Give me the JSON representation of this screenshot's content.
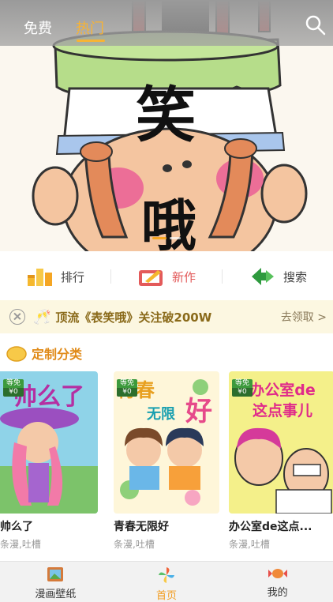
{
  "top_tabs": {
    "free": "免费",
    "hot": "热门"
  },
  "hero": {
    "big_char_1": "笑",
    "big_char_2": "哦"
  },
  "quick_nav": [
    {
      "label": "排行",
      "icon": "ranking-icon"
    },
    {
      "label": "新作",
      "icon": "new-work-icon"
    },
    {
      "label": "搜索",
      "icon": "search-arrows-icon"
    }
  ],
  "notice": {
    "text": "顶流《表笑哦》关注破200W",
    "action": "去领取 >"
  },
  "section": {
    "title": "定制分类"
  },
  "badge": {
    "line1": "等免",
    "line2": "¥0"
  },
  "cards": [
    {
      "cover_text": "帅么了",
      "title": "帅么了",
      "tags": "条漫,吐槽"
    },
    {
      "cover_text_1": "青春",
      "cover_text_2": "无限",
      "cover_text_3": "好",
      "title": "青春无限好",
      "tags": "条漫,吐槽"
    },
    {
      "cover_text_1": "办公室de",
      "cover_text_2": "这点事儿",
      "title": "办公室de这点...",
      "tags": "条漫,吐槽"
    }
  ],
  "bottom_tabs": [
    {
      "label": "漫画壁纸"
    },
    {
      "label": "首页"
    },
    {
      "label": "我的"
    }
  ],
  "colors": {
    "accent": "#f29c1f",
    "notice_bg": "#fcf7e1",
    "section_title": "#e08a18"
  }
}
